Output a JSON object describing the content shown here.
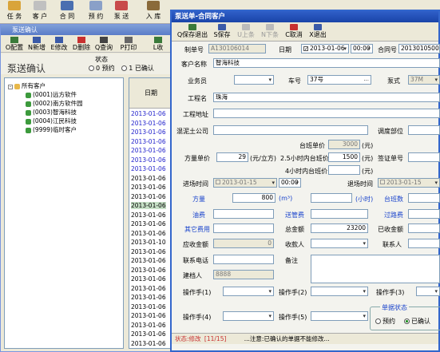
{
  "main_toolbar": {
    "items": [
      {
        "label": "任 务",
        "icon": "task-icon",
        "color": "#d9a43a"
      },
      {
        "label": "客 户",
        "icon": "customer-icon",
        "color": "#c0c0c0"
      },
      {
        "label": "合 同",
        "icon": "contract-icon",
        "color": "#4a6fb0"
      },
      {
        "label": "预 约",
        "icon": "appointment-icon",
        "color": "#8aa0c8"
      },
      {
        "label": "泵 送",
        "icon": "pump-icon",
        "color": "#c84a4a"
      },
      {
        "label": "入 库",
        "icon": "warehouse-icon",
        "color": "#8a6a3a"
      }
    ]
  },
  "left_window": {
    "title": "泵送确认",
    "toolbar": [
      {
        "label": "O配置",
        "icon": "config-icon",
        "color": "#3a7a3a"
      },
      {
        "label": "N新增",
        "icon": "add-icon",
        "color": "#3a5aa8"
      },
      {
        "label": "E修改",
        "icon": "edit-icon",
        "color": "#3a5aa8"
      },
      {
        "label": "D删除",
        "icon": "delete-icon",
        "color": "#c83030"
      },
      {
        "label": "Q查询",
        "icon": "query-icon",
        "color": "#444"
      },
      {
        "label": "P打印",
        "icon": "print-icon",
        "color": "#666"
      },
      {
        "label": "L收",
        "icon": "receive-icon",
        "color": "#3a7a3a"
      }
    ],
    "header_label": "泵送确认",
    "status_group": {
      "title": "状态",
      "options": [
        "0 预约",
        "1 已确认"
      ]
    },
    "tree": {
      "root": "所有客户",
      "items": [
        "(0001)远方软件",
        "(0002)南方软件园",
        "(0003)智海科技",
        "(0004)江民科技",
        "(9999)临时客户"
      ]
    },
    "date_column": {
      "header": "日期",
      "rows": [
        {
          "text": "2013-01-06",
          "blue": true
        },
        {
          "text": "2013-01-06",
          "blue": true
        },
        {
          "text": "2013-01-06",
          "blue": true
        },
        {
          "text": "2013-01-06",
          "blue": true
        },
        {
          "text": "2013-01-06",
          "blue": true
        },
        {
          "text": "2013-01-06",
          "blue": true
        },
        {
          "text": "2013-01-06",
          "blue": true
        },
        {
          "text": "2013-01-06",
          "blue": false
        },
        {
          "text": "2013-01-06",
          "blue": false
        },
        {
          "text": "2013-01-06",
          "blue": false
        },
        {
          "text": "2013-01-06",
          "blue": false,
          "selected": true
        },
        {
          "text": "2013-01-06",
          "blue": false
        },
        {
          "text": "2013-01-06",
          "blue": false
        },
        {
          "text": "2013-01-06",
          "blue": false
        },
        {
          "text": "2013-01-10",
          "blue": false
        },
        {
          "text": "2013-01-06",
          "blue": false
        },
        {
          "text": "2013-01-06",
          "blue": false
        },
        {
          "text": "2013-01-06",
          "blue": false
        },
        {
          "text": "2013-01-06",
          "blue": false
        },
        {
          "text": "2013-01-06",
          "blue": false
        },
        {
          "text": "2013-01-06",
          "blue": false
        },
        {
          "text": "2013-01-06",
          "blue": false
        },
        {
          "text": "2013-01-06",
          "blue": false
        },
        {
          "text": "2013-01-06",
          "blue": false
        },
        {
          "text": "2013-01-06",
          "blue": false
        },
        {
          "text": "2013-01-06",
          "blue": false
        }
      ]
    }
  },
  "right_window": {
    "title": "泵送单-合同客户",
    "toolbar": [
      {
        "label": "Q保存退出",
        "icon": "save-exit-icon",
        "color": "#3a7a3a",
        "disabled": false
      },
      {
        "label": "S保存",
        "icon": "save-icon",
        "color": "#3a5aa8",
        "disabled": false
      },
      {
        "label": "U上条",
        "icon": "up-icon",
        "color": "#999",
        "disabled": true
      },
      {
        "label": "N下条",
        "icon": "down-icon",
        "color": "#999",
        "disabled": true
      },
      {
        "label": "C取消",
        "icon": "cancel-icon",
        "color": "#c83030",
        "disabled": false
      },
      {
        "label": "X退出",
        "icon": "exit-icon",
        "color": "#3a5aa8",
        "disabled": false
      }
    ],
    "form": {
      "bill_no_label": "制单号",
      "bill_no": "A130106014",
      "date_label": "日期",
      "date": "2013-01-06",
      "time": "00:00",
      "contract_no_label": "合同号",
      "contract_no": "2013010500",
      "customer_name_label": "客户名称",
      "customer_name": "智海科技",
      "salesman_label": "业务员",
      "salesman": "",
      "car_no_label": "车号",
      "car_no": "37号",
      "pump_type_label": "泵式",
      "pump_type": "37M",
      "project_name_label": "工程名",
      "project_name": "珠海",
      "project_addr_label": "工程地址",
      "project_addr": "",
      "concrete_co_label": "混泥土公司",
      "concrete_co": "",
      "dispatch_dept_label": "调度部位",
      "shift_price_label": "台班单价",
      "shift_price": "3000",
      "shift_price_unit": "(元)",
      "volume_price_label": "方量单价",
      "volume_price": "29",
      "volume_price_unit": "(元/立方)",
      "within_25h_label": "2.5小时内台班价",
      "within_25h": "1500",
      "within_25h_unit": "(元)",
      "within_4h_label": "4小时内台班价",
      "within_4h": "",
      "within_4h_unit": "(元)",
      "sign_bill_label": "签证单号",
      "enter_time_label": "进场时间",
      "enter_date": "2013-01-15",
      "enter_time": "00:00",
      "exit_time_label": "退场时间",
      "exit_date": "2013-01-15",
      "volume_label": "方量",
      "volume": "800",
      "volume_unit": "(m³)",
      "hours_unit": "(小时)",
      "shifts_label": "台班数",
      "oil_fee_label": "油费",
      "pipe_fee_label": "送管费",
      "toll_fee_label": "过路费",
      "other_fee_label": "其它费用",
      "total_label": "总金额",
      "total": "23200",
      "received_label": "已收金额",
      "receivable_label": "应收金额",
      "receivable": "0",
      "payee_label": "收款人",
      "contact_label": "联系人",
      "phone_label": "联系电话",
      "remark_label": "备注",
      "creator_label": "建档人",
      "creator": "8888",
      "operator1_label": "操作手(1)",
      "operator2_label": "操作手(2)",
      "operator3_label": "操作手(3)",
      "operator4_label": "操作手(4)",
      "operator5_label": "操作手(5)",
      "bill_status_title": "单据状态",
      "bill_status_options": [
        "预约",
        "已确认"
      ]
    },
    "status_bar": {
      "mode": "状态:修改",
      "position": "[11/15]",
      "note": "...注意:已确认的单据不能修改..."
    }
  }
}
